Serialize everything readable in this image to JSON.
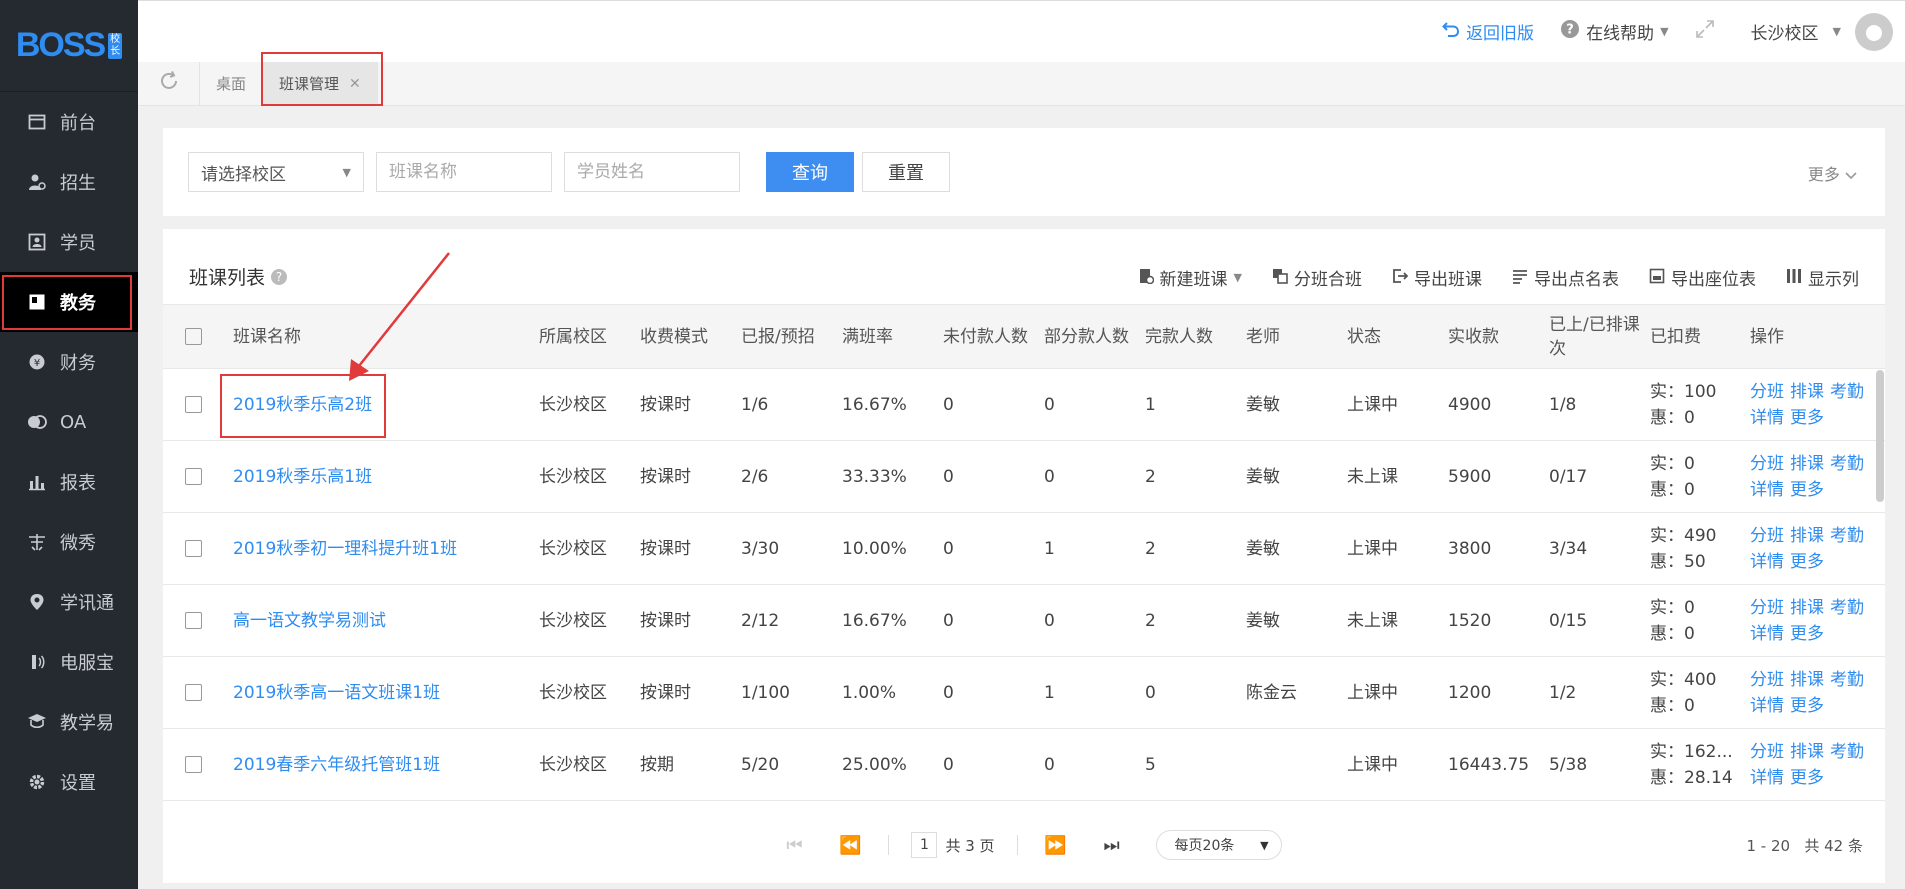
{
  "logo": {
    "text": "BOSS",
    "badge": [
      "校",
      "长"
    ]
  },
  "sidebar": {
    "items": [
      {
        "label": "前台",
        "icon": "calendar-icon"
      },
      {
        "label": "招生",
        "icon": "user-add-icon"
      },
      {
        "label": "学员",
        "icon": "id-card-icon"
      },
      {
        "label": "教务",
        "icon": "book-icon",
        "active": true
      },
      {
        "label": "财务",
        "icon": "yen-icon"
      },
      {
        "label": "OA",
        "icon": "oa-icon"
      },
      {
        "label": "报表",
        "icon": "bar-chart-icon"
      },
      {
        "label": "微秀",
        "icon": "wechat-show-icon"
      },
      {
        "label": "学讯通",
        "icon": "location-icon"
      },
      {
        "label": "电服宝",
        "icon": "phone-service-icon"
      },
      {
        "label": "教学易",
        "icon": "teach-icon"
      },
      {
        "label": "设置",
        "icon": "gear-icon"
      }
    ]
  },
  "topbar": {
    "back_old": "返回旧版",
    "help": "在线帮助",
    "campus": "长沙校区"
  },
  "tabs": [
    {
      "label": "桌面"
    },
    {
      "label": "班课管理",
      "active": true
    }
  ],
  "filter": {
    "campus_placeholder": "请选择校区",
    "class_name_placeholder": "班课名称",
    "student_name_placeholder": "学员姓名",
    "search_label": "查询",
    "reset_label": "重置",
    "more_label": "更多"
  },
  "list": {
    "title": "班课列表",
    "actions": [
      "新建班课",
      "分班合班",
      "导出班课",
      "导出点名表",
      "导出座位表",
      "显示列"
    ],
    "columns": [
      "班课名称",
      "所属校区",
      "收费模式",
      "已报/预招",
      "满班率",
      "未付款人数",
      "部分款人数",
      "完款人数",
      "老师",
      "状态",
      "实收款",
      "已上/已排课次",
      "已扣费",
      "操作"
    ],
    "rows": [
      {
        "name": "2019秋季乐高2班",
        "campus": "长沙校区",
        "mode": "按课时",
        "enrolled": "1/6",
        "rate": "16.67%",
        "unpaid": "0",
        "partial": "0",
        "paid": "1",
        "teacher": "姜敏",
        "status": "上课中",
        "received": "4900",
        "sessions": "1/8",
        "fee_real": "实：100",
        "fee_disc": "惠：0"
      },
      {
        "name": "2019秋季乐高1班",
        "campus": "长沙校区",
        "mode": "按课时",
        "enrolled": "2/6",
        "rate": "33.33%",
        "unpaid": "0",
        "partial": "0",
        "paid": "2",
        "teacher": "姜敏",
        "status": "未上课",
        "received": "5900",
        "sessions": "0/17",
        "fee_real": "实：0",
        "fee_disc": "惠：0"
      },
      {
        "name": "2019秋季初一理科提升班1班",
        "campus": "长沙校区",
        "mode": "按课时",
        "enrolled": "3/30",
        "rate": "10.00%",
        "unpaid": "0",
        "partial": "1",
        "paid": "2",
        "teacher": "姜敏",
        "status": "上课中",
        "received": "3800",
        "sessions": "3/34",
        "fee_real": "实：490",
        "fee_disc": "惠：50"
      },
      {
        "name": "高一语文教学易测试",
        "campus": "长沙校区",
        "mode": "按课时",
        "enrolled": "2/12",
        "rate": "16.67%",
        "unpaid": "0",
        "partial": "0",
        "paid": "2",
        "teacher": "姜敏",
        "status": "未上课",
        "received": "1520",
        "sessions": "0/15",
        "fee_real": "实：0",
        "fee_disc": "惠：0"
      },
      {
        "name": "2019秋季高一语文班课1班",
        "campus": "长沙校区",
        "mode": "按课时",
        "enrolled": "1/100",
        "rate": "1.00%",
        "unpaid": "0",
        "partial": "1",
        "paid": "0",
        "teacher": "陈金云",
        "status": "上课中",
        "received": "1200",
        "sessions": "1/2",
        "fee_real": "实：400",
        "fee_disc": "惠：0"
      },
      {
        "name": "2019春季六年级托管班1班",
        "campus": "长沙校区",
        "mode": "按期",
        "enrolled": "5/20",
        "rate": "25.00%",
        "unpaid": "0",
        "partial": "0",
        "paid": "5",
        "teacher": "",
        "status": "上课中",
        "received": "16443.75",
        "sessions": "5/38",
        "fee_real": "实：162...",
        "fee_disc": "惠：28.14"
      }
    ],
    "ops": [
      "分班",
      "排课",
      "考勤",
      "详情",
      "更多"
    ]
  },
  "pager": {
    "page": "1",
    "total_pages": "共 3 页",
    "page_size": "每页20条",
    "range": "1 - 20",
    "total": "共 42 条"
  }
}
